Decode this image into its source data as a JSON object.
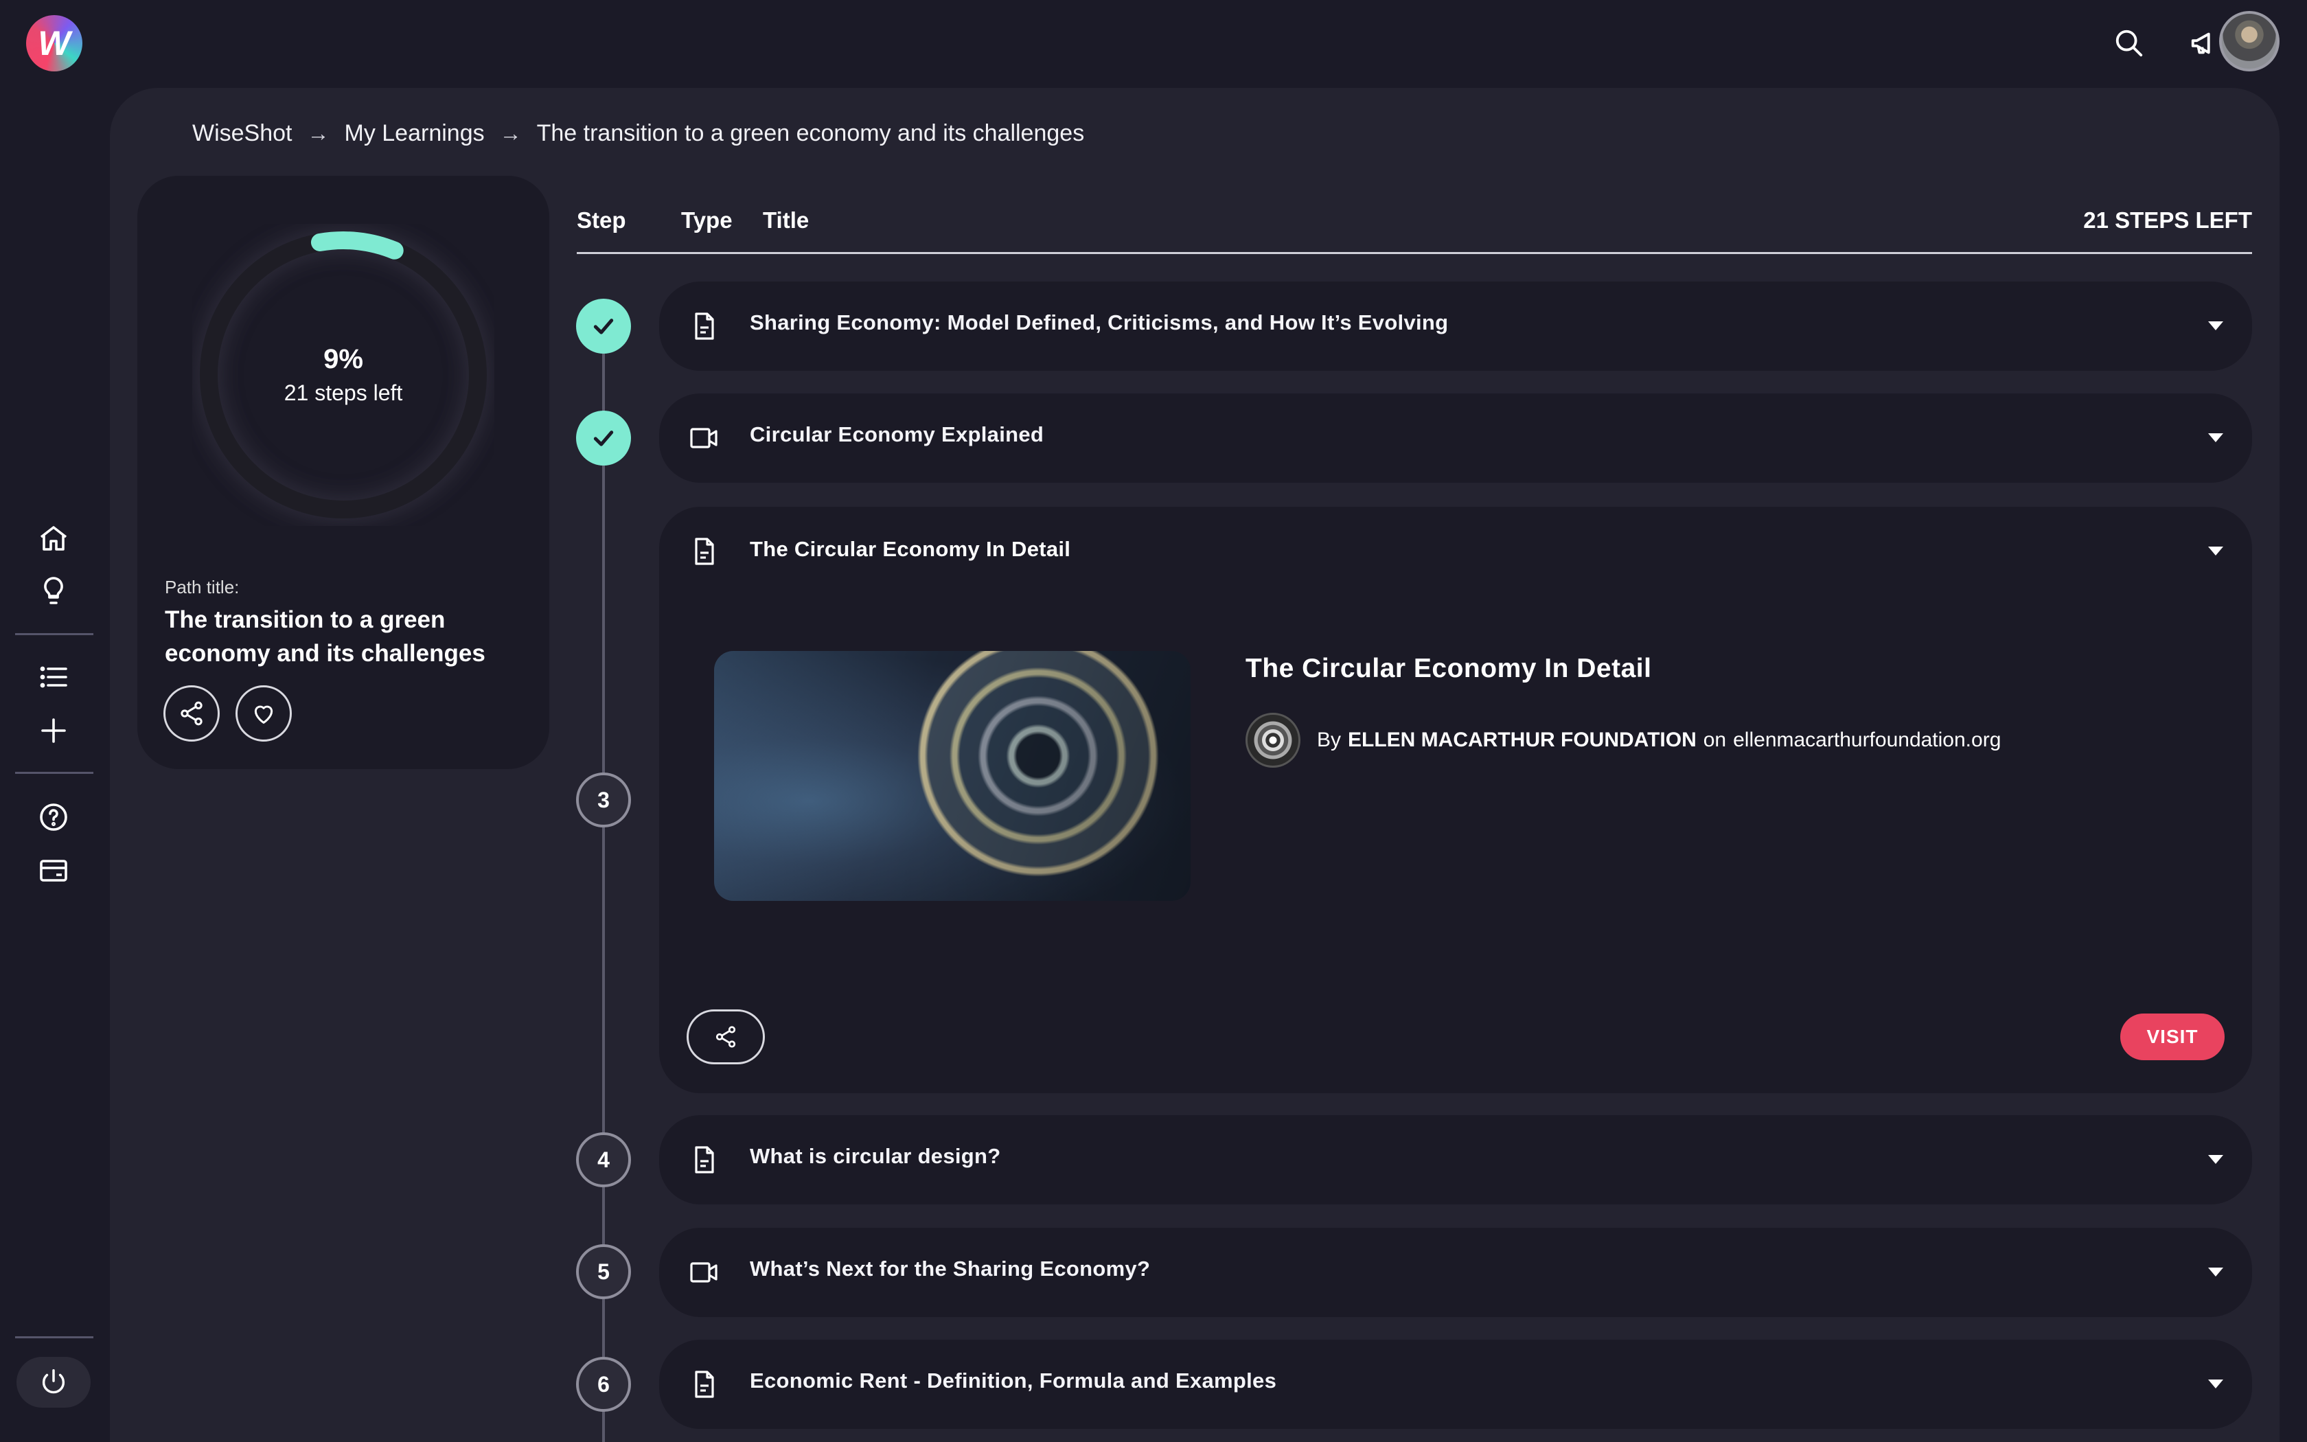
{
  "app": {
    "logo_letter": "W",
    "brand_colors": {
      "accent": "#7fead2",
      "visit": "#e9435f",
      "background": "#1b1a27",
      "panel": "#242330"
    }
  },
  "topbar": {
    "icons": [
      "search-icon",
      "megaphone-icon",
      "avatar"
    ]
  },
  "sidebar": {
    "items": [
      {
        "icon": "home-icon"
      },
      {
        "icon": "lightbulb-icon"
      },
      {
        "icon": "list-icon"
      },
      {
        "icon": "plus-icon"
      },
      {
        "icon": "help-icon"
      },
      {
        "icon": "card-icon"
      },
      {
        "icon": "power-icon"
      }
    ]
  },
  "breadcrumb": {
    "items": [
      "WiseShot",
      "My Learnings",
      "The transition to a green economy and its challenges"
    ]
  },
  "progress": {
    "percent_label": "9%",
    "percent": 9,
    "steps_left_label": "21 steps left",
    "path_label": "Path title:",
    "path_title": "The transition to a green economy and its challenges"
  },
  "list": {
    "header_step": "Step",
    "header_type": "Type",
    "header_title": "Title",
    "steps_left": "21 STEPS LEFT",
    "steps": [
      {
        "marker": "",
        "status": "done",
        "type": "document-icon",
        "title": "Sharing Economy: Model Defined, Criticisms, and How It’s Evolving"
      },
      {
        "marker": "",
        "status": "done",
        "type": "video-icon",
        "title": "Circular Economy Explained"
      },
      {
        "marker": "3",
        "status": "open",
        "type": "document-icon",
        "title": "The Circular Economy In Detail"
      },
      {
        "marker": "4",
        "status": "pending",
        "type": "document-icon",
        "title": "What is circular design?"
      },
      {
        "marker": "5",
        "status": "pending",
        "type": "video-icon",
        "title": "What’s Next for the Sharing Economy?"
      },
      {
        "marker": "6",
        "status": "pending",
        "type": "document-icon",
        "title": "Economic Rent - Definition, Formula and Examples"
      }
    ],
    "expanded": {
      "resource_title": "The Circular Economy In Detail",
      "by": "By",
      "author": "ELLEN MACARTHUR FOUNDATION",
      "on": "on",
      "domain": "ellenmacarthurfoundation.org",
      "visit_label": "VISIT"
    }
  }
}
